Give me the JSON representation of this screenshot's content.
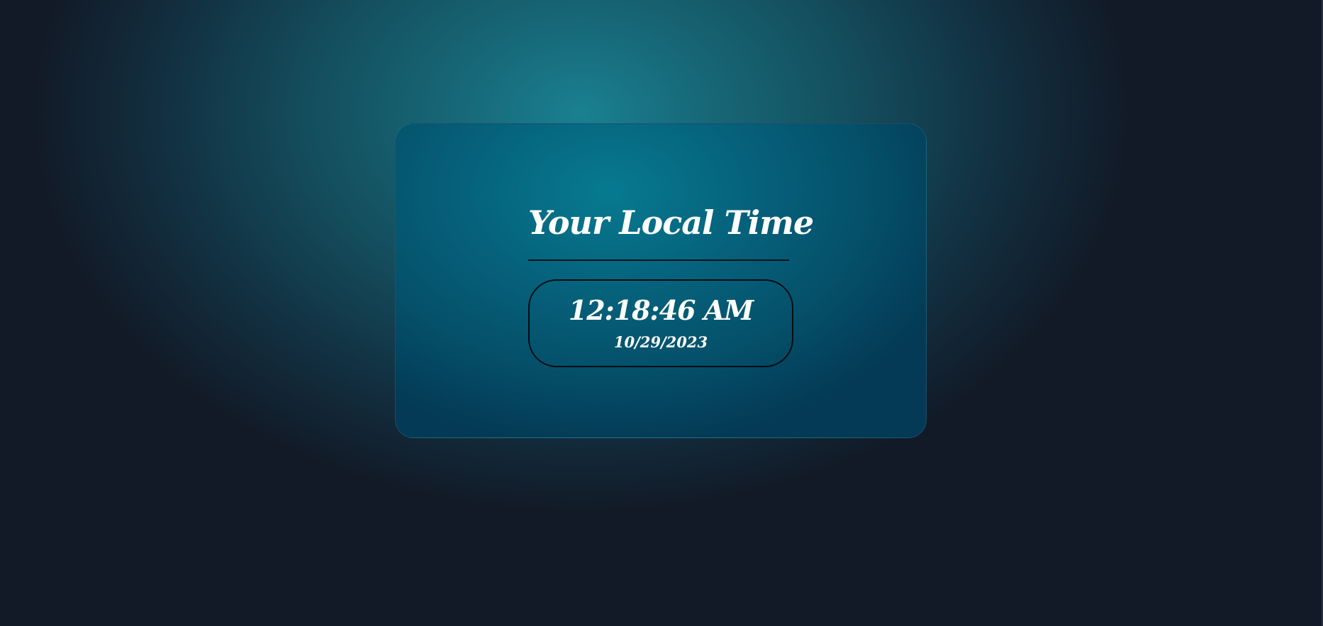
{
  "clock": {
    "title": "Your Local Time",
    "time": "12:18:46 AM",
    "date": "10/29/2023"
  },
  "colors": {
    "background_dark": "#121a27",
    "background_glow": "#1a8090",
    "card": "#06617b",
    "text": "#ffffff",
    "border": "#050d12"
  }
}
